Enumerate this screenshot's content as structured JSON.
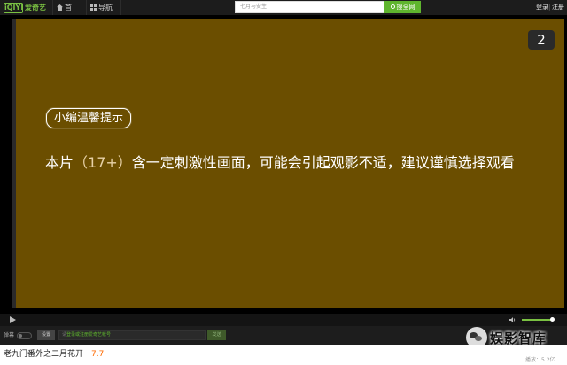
{
  "header": {
    "logo_box": "iQIYI",
    "logo_text": "爱奇艺",
    "nav_home": "首页",
    "nav_guide": "导航",
    "search_placeholder": "七月与安生",
    "search_button": "搜全网",
    "login": "登录",
    "separator": "|",
    "register": "注册"
  },
  "player": {
    "badge": "2",
    "notice_title": "小编温馨提示",
    "notice_pre": "本片",
    "notice_rating": "（17+）",
    "notice_post": "含一定刺激性画面，可能会引起观影不适，建议谨慎选择观看",
    "volume_level": 0.95
  },
  "danmaku": {
    "label": "弹幕",
    "settings": "设置",
    "input_prefix": "请",
    "input_link": "登录",
    "input_suffix": "或注册爱奇艺帐号",
    "send": "发送"
  },
  "footer": {
    "title": "老九门番外之二月花开",
    "score": "7.7",
    "watermark": "娱影智库",
    "right_text": "播放：5 2亿"
  }
}
